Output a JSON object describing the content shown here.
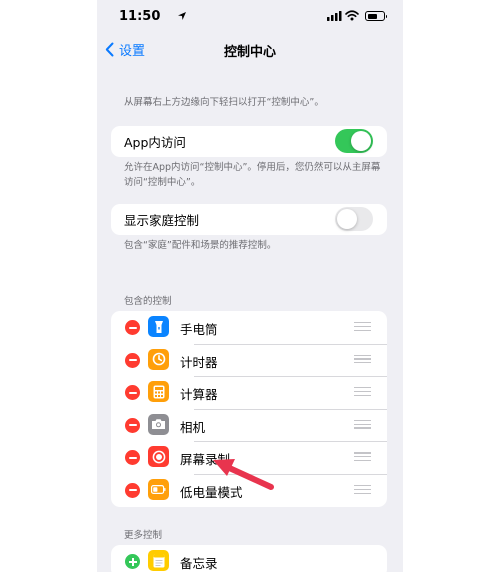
{
  "status_bar": {
    "time": "11:50"
  },
  "navbar": {
    "back_label": "设置",
    "title": "控制中心"
  },
  "intro_note": "从屏幕右上方边缘向下轻扫以打开“控制中心”。",
  "app_access": {
    "label": "App内访问",
    "enabled": true,
    "note": "允许在App内访问“控制中心”。停用后，您仍然可以从主屏幕访问“控制中心”。"
  },
  "home_controls": {
    "label": "显示家庭控制",
    "enabled": false,
    "note": "包含“家庭”配件和场景的推荐控制。"
  },
  "included_section": {
    "header": "包含的控制",
    "items": [
      {
        "label": "手电筒",
        "icon": "flashlight-icon",
        "color": "#0a84ff"
      },
      {
        "label": "计时器",
        "icon": "timer-icon",
        "color": "#ff9f0a"
      },
      {
        "label": "计算器",
        "icon": "calculator-icon",
        "color": "#ff9f0a"
      },
      {
        "label": "相机",
        "icon": "camera-icon",
        "color": "#8e8e93"
      },
      {
        "label": "屏幕录制",
        "icon": "screen-recording-icon",
        "color": "#ff3b30"
      },
      {
        "label": "低电量模式",
        "icon": "low-power-icon",
        "color": "#ff9f0a"
      }
    ]
  },
  "more_section": {
    "header": "更多控制",
    "items": [
      {
        "label": "备忘录",
        "icon": "notes-icon",
        "color": "#ffcc00"
      }
    ]
  },
  "colors": {
    "accent": "#0a7aff",
    "toggle_on": "#34c759",
    "delete": "#ff3b30",
    "annotation_arrow": "#e8344e"
  }
}
